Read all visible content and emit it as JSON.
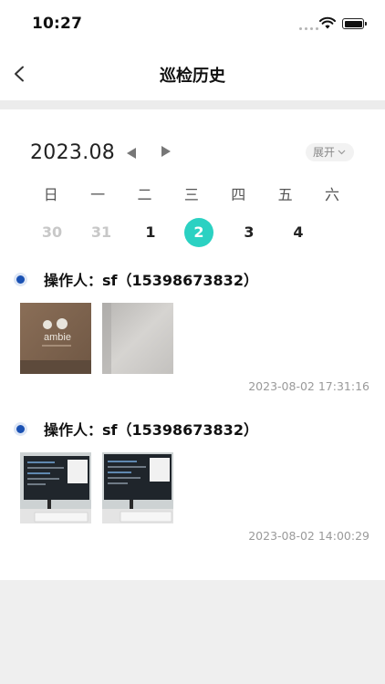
{
  "status_bar": {
    "time": "10:27"
  },
  "nav": {
    "title": "巡检历史"
  },
  "calendar": {
    "month": "2023.08",
    "expand_label": "展开",
    "weekdays": [
      "日",
      "一",
      "二",
      "三",
      "四",
      "五",
      "六"
    ],
    "dates": [
      {
        "label": "30",
        "state": "muted"
      },
      {
        "label": "31",
        "state": "muted"
      },
      {
        "label": "1",
        "state": "normal"
      },
      {
        "label": "2",
        "state": "selected"
      },
      {
        "label": "3",
        "state": "normal"
      },
      {
        "label": "4",
        "state": "normal"
      }
    ],
    "accent_color": "#2bd1c2"
  },
  "records": [
    {
      "operator": "操作人：sf（15398673832）",
      "time": "2023-08-02 17:31:16",
      "photos": [
        "box-photo-ambie",
        "blurry-white-photo"
      ],
      "photo_text": "ambie"
    },
    {
      "operator": "操作人：sf（15398673832）",
      "time": "2023-08-02 14:00:29",
      "photos": [
        "monitor-keyboard-photo",
        "monitor-keyboard-photo"
      ]
    }
  ],
  "dot_color": "#1a51b3"
}
